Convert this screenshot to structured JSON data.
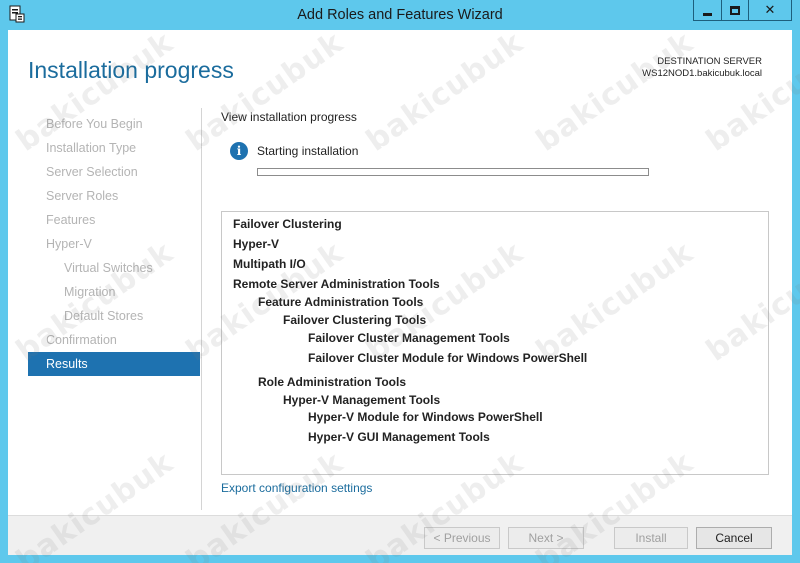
{
  "window": {
    "title": "Add Roles and Features Wizard"
  },
  "header": {
    "title": "Installation progress",
    "destination_label": "DESTINATION SERVER",
    "destination_server": "WS12NOD1.bakicubuk.local"
  },
  "nav": {
    "items": [
      {
        "label": "Before You Begin"
      },
      {
        "label": "Installation Type"
      },
      {
        "label": "Server Selection"
      },
      {
        "label": "Server Roles"
      },
      {
        "label": "Features"
      },
      {
        "label": "Hyper-V"
      },
      {
        "label": "Virtual Switches"
      },
      {
        "label": "Migration"
      },
      {
        "label": "Default Stores"
      },
      {
        "label": "Confirmation"
      },
      {
        "label": "Results"
      }
    ],
    "active": "Results"
  },
  "main": {
    "section_title": "View installation progress",
    "status_text": "Starting installation",
    "progress_fraction": 0.0,
    "features": [
      {
        "label": "Failover Clustering",
        "level": 0
      },
      {
        "label": "Hyper-V",
        "level": 0
      },
      {
        "label": "Multipath I/O",
        "level": 0
      },
      {
        "label": "Remote Server Administration Tools",
        "level": 0
      },
      {
        "label": "Feature Administration Tools",
        "level": 1
      },
      {
        "label": "Failover Clustering Tools",
        "level": 2
      },
      {
        "label": "Failover Cluster Management Tools",
        "level": 3
      },
      {
        "label": "Failover Cluster Module for Windows PowerShell",
        "level": 3
      },
      {
        "label": "Role Administration Tools",
        "level": 1
      },
      {
        "label": "Hyper-V Management Tools",
        "level": 2
      },
      {
        "label": "Hyper-V Module for Windows PowerShell",
        "level": 3
      },
      {
        "label": "Hyper-V GUI Management Tools",
        "level": 3
      }
    ],
    "export_link": "Export configuration settings"
  },
  "footer": {
    "previous_label": "< Previous",
    "next_label": "Next >",
    "install_label": "Install",
    "cancel_label": "Cancel"
  },
  "watermark": "bakicubuk",
  "colors": {
    "titlebar": "#5ec8ec",
    "accent": "#1e72b0",
    "header_text": "#1b6c9d"
  }
}
